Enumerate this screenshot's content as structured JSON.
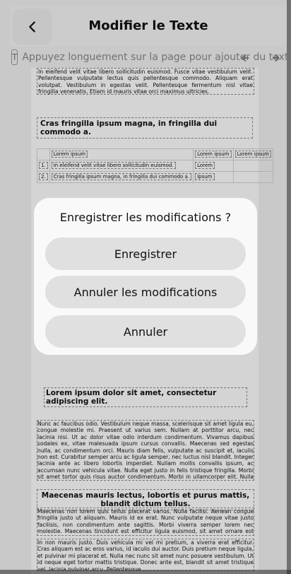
{
  "header": {
    "title": "Modifier le Texte"
  },
  "hint": {
    "text": "Appuyez longuement sur la page pour ajouter du texte",
    "icon": "text-insert-icon"
  },
  "document": {
    "top_para": "In eleifend velit vitae libero sollicitudin euismod. Fusce vitae vestibulum velit. Pellentesque vulputate lectus quis pellentesque commodo. Aliquam erat volutpat. Vestibulum in egestas velit. Pellentesque fermentum nisl vitae fringilla venenatis. Etiam id mauris vitae orci maximus ultricies.",
    "heading1": "Cras fringilla ipsum magna, in fringilla dui commodo a.",
    "table": {
      "header": [
        "",
        "Lorem ipsum",
        "Lorem ipsum",
        "Lorem ipsum"
      ],
      "rows": [
        [
          "1.",
          "In eleifend velit vitae libero sollicitudin euismod.",
          "Lorem",
          ""
        ],
        [
          "2.",
          "Cras fringilla ipsum magna, in fringilla dui commodo a.",
          "Ipsum",
          ""
        ]
      ]
    },
    "heading2": "Lorem ipsum dolor sit amet, consectetur adipiscing elit.",
    "para2": "Nunc ac faucibus odio. Vestibulum neque massa, scelerisque sit amet ligula eu, congue molestie mi. Praesent ut varius sem. Nullam at porttitor arcu, nec lacinia nisi. Ut ac dolor vitae odio interdum condimentum. Vivamus dapibus sodales ex, vitae malesuada ipsum cursus convallis. Maecenas sed egestas nulla, ac condimentum orci. Mauris diam felis, vulputate ac suscipit et, iaculis non est. Curabitur semper arcu ac ligula semper, nec luctus nisl blandit. Integer lacinia ante ac libero lobortis imperdiet. Nullam mollis convallis ipsum, ac accumsan nunc vehicula vitae. Nulla eget justo in felis tristique fringilla. Morbi sit amet tortor quis risus auctor condimentum. Morbi in ullamcorper elit. Nulla iaculis tellus sit amet mauris tempus fringilla.",
    "heading3": "Maecenas mauris lectus, lobortis et purus mattis, blandit dictum tellus.",
    "para3": "Maecenas non lorem quis tellus placerat varius. Nulla facilisi. Aenean congue fringilla justo ut aliquam. Mauris id ex erat. Nunc vulputate neque vitae justo facilisis, non condimentum ante sagittis. Morbi viverra semper lorem nec molestie. Maecenas tincidunt est efficitur ligula euismod, sit amet ornare est vulputate.",
    "para4": "In non mauris justo. Duis vehicula mi vel mi pretium, a viverra erat efficitur. Cras aliquam est ac eros varius, id iaculis dui auctor. Duis pretium neque ligula, et pulvinar mi placerat et. Nulla nec nunc sit amet nunc posuere vestibulum. Ut id neque eget tortor mattis tristique. Donec ante est, blandit sit amet tristique vel, lacinia pulvinar arcu. Pellentesque"
  },
  "dialog": {
    "title": "Enregistrer les modifications ?",
    "save": "Enregistrer",
    "discard": "Annuler les modifications",
    "cancel": "Annuler"
  }
}
